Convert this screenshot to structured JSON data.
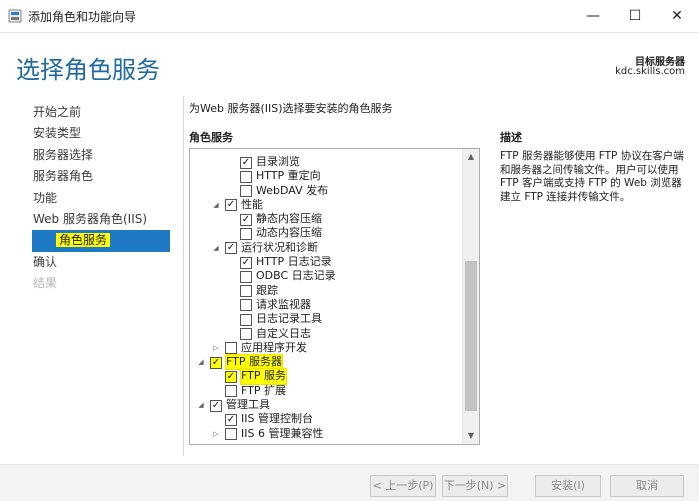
{
  "window": {
    "title": "添加角色和功能向导",
    "minimize": "—",
    "maximize": "☐",
    "close": "✕"
  },
  "page": {
    "heading": "选择角色服务",
    "target_server_label": "目标服务器",
    "target_server_value": "kdc.skills.com"
  },
  "nav": {
    "items": [
      {
        "label": "开始之前",
        "state": "normal"
      },
      {
        "label": "安装类型",
        "state": "normal"
      },
      {
        "label": "服务器选择",
        "state": "normal"
      },
      {
        "label": "服务器角色",
        "state": "normal"
      },
      {
        "label": "功能",
        "state": "normal"
      },
      {
        "label": "Web 服务器角色(IIS)",
        "state": "normal"
      },
      {
        "label": "角色服务",
        "state": "active"
      },
      {
        "label": "确认",
        "state": "normal"
      },
      {
        "label": "结果",
        "state": "disabled"
      }
    ]
  },
  "main": {
    "instruction": "为Web 服务器(IIS)选择要安装的角色服务",
    "roles_header": "角色服务",
    "tree": [
      {
        "label": "目录浏览",
        "level": 2,
        "checked": true,
        "expander": ""
      },
      {
        "label": "HTTP 重定向",
        "level": 2,
        "checked": false,
        "expander": ""
      },
      {
        "label": "WebDAV 发布",
        "level": 2,
        "checked": false,
        "expander": ""
      },
      {
        "label": "性能",
        "level": 1,
        "checked": true,
        "expander": "open"
      },
      {
        "label": "静态内容压缩",
        "level": 2,
        "checked": true,
        "expander": ""
      },
      {
        "label": "动态内容压缩",
        "level": 2,
        "checked": false,
        "expander": ""
      },
      {
        "label": "运行状况和诊断",
        "level": 1,
        "checked": true,
        "expander": "open"
      },
      {
        "label": "HTTP 日志记录",
        "level": 2,
        "checked": true,
        "expander": ""
      },
      {
        "label": "ODBC 日志记录",
        "level": 2,
        "checked": false,
        "expander": ""
      },
      {
        "label": "跟踪",
        "level": 2,
        "checked": false,
        "expander": ""
      },
      {
        "label": "请求监视器",
        "level": 2,
        "checked": false,
        "expander": ""
      },
      {
        "label": "日志记录工具",
        "level": 2,
        "checked": false,
        "expander": ""
      },
      {
        "label": "自定义日志",
        "level": 2,
        "checked": false,
        "expander": ""
      },
      {
        "label": "应用程序开发",
        "level": 1,
        "checked": false,
        "expander": "closed"
      },
      {
        "label": "FTP 服务器",
        "level": 0,
        "checked": true,
        "expander": "open",
        "highlight": true
      },
      {
        "label": "FTP 服务",
        "level": 1,
        "checked": true,
        "expander": "",
        "highlight": true
      },
      {
        "label": "FTP 扩展",
        "level": 1,
        "checked": false,
        "expander": ""
      },
      {
        "label": "管理工具",
        "level": 0,
        "checked": true,
        "expander": "open"
      },
      {
        "label": "IIS 管理控制台",
        "level": 1,
        "checked": true,
        "expander": ""
      },
      {
        "label": "IIS 6 管理兼容性",
        "level": 1,
        "checked": false,
        "expander": "closed"
      }
    ]
  },
  "description": {
    "header": "描述",
    "text": "FTP 服务器能够使用 FTP 协议在客户端和服务器之间传输文件。用户可以使用 FTP 客户端或支持 FTP 的 Web 浏览器建立 FTP 连接并传输文件。"
  },
  "footer": {
    "prev": "< 上一步(P)",
    "next": "下一步(N) >",
    "install": "安装(I)",
    "cancel": "取消"
  },
  "colors": {
    "accent": "#1f7ac6",
    "heading": "#1e6aa3",
    "highlight": "#ffff00"
  }
}
